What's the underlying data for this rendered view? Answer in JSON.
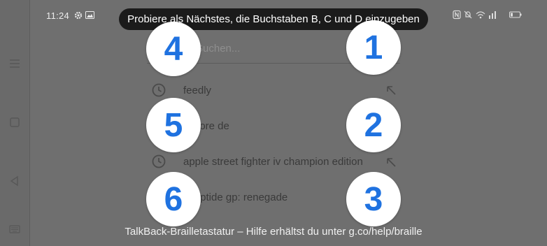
{
  "status_bar": {
    "time": "11:24",
    "left_icons": [
      "gear-icon",
      "image-icon"
    ],
    "right_icons": [
      "nfc-icon",
      "mute-icon",
      "wifi-icon",
      "signal-icon",
      "battery-icon"
    ]
  },
  "toast": {
    "text": "Probiere als Nächstes, die Buchstaben B, C und D einzugeben"
  },
  "search": {
    "placeholder_visible": "Suchen..."
  },
  "suggestions": [
    {
      "text": "feedly",
      "has_clock": true,
      "has_arrow": true
    },
    {
      "text": "y store de",
      "has_clock": false,
      "has_arrow": false
    },
    {
      "text": "apple street fighter iv champion edition",
      "has_clock": true,
      "has_arrow": true
    },
    {
      "text": "le riptide gp: renegade",
      "has_clock": false,
      "has_arrow": false
    }
  ],
  "braille_dots": [
    "1",
    "2",
    "3",
    "4",
    "5",
    "6"
  ],
  "footer": {
    "text": "TalkBack-Brailletastatur – Hilfe erhältst du unter g.co/help/braille"
  },
  "colors": {
    "overlay": "#6f6f6f",
    "dot_fill": "#ffffff",
    "dot_number": "#1f72e0",
    "toast_bg": "#1b1b1b"
  }
}
